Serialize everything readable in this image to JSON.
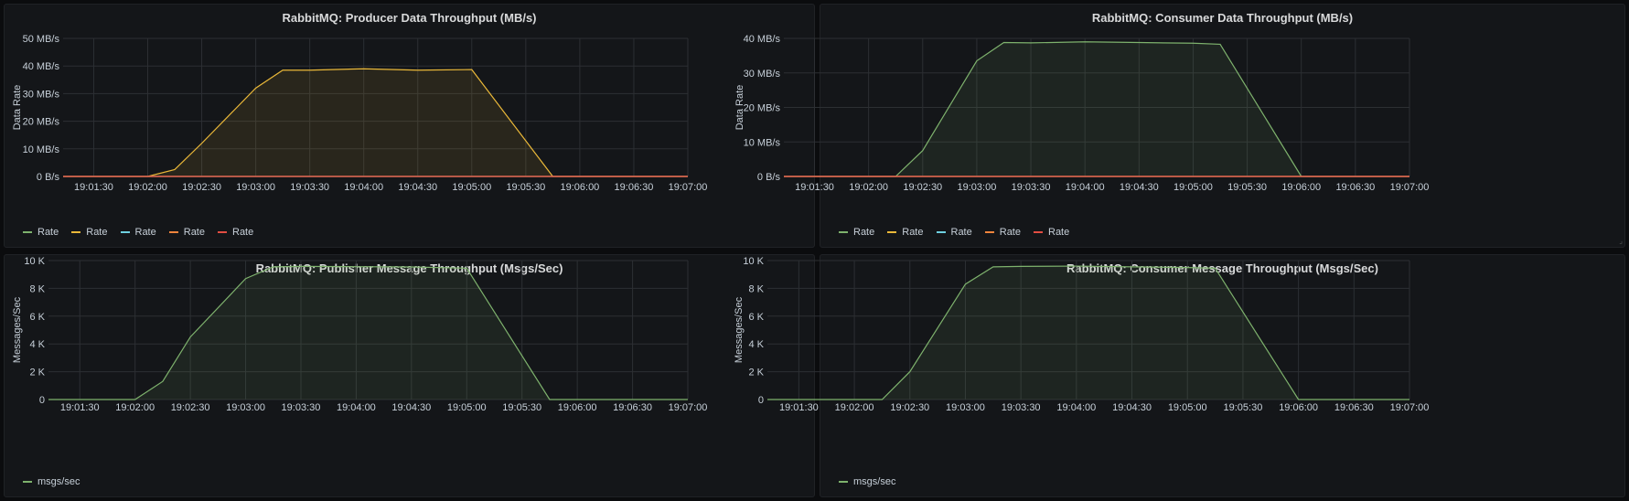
{
  "time_ticks": [
    "19:01:30",
    "19:02:00",
    "19:02:30",
    "19:03:00",
    "19:03:30",
    "19:04:00",
    "19:04:30",
    "19:05:00",
    "19:05:30",
    "19:06:00",
    "19:06:30",
    "19:07:00"
  ],
  "colors": {
    "green": "#7eb26d",
    "yellow": "#eab839",
    "teal": "#6ed0e0",
    "orange": "#ef843c",
    "red": "#e24d42",
    "grid": "#2c2f33",
    "text": "#c7d0d9"
  },
  "chart_data": [
    {
      "id": "producer",
      "type": "area",
      "title": "RabbitMQ: Producer Data Throughput (MB/s)",
      "ylabel": "Data Rate",
      "xlim": [
        "19:01:13",
        "19:07:00"
      ],
      "ylim": [
        0,
        50
      ],
      "yticks": [
        0,
        10,
        20,
        30,
        40,
        50
      ],
      "ytick_labels": [
        "0 B/s",
        "10 MB/s",
        "20 MB/s",
        "30 MB/s",
        "40 MB/s",
        "50 MB/s"
      ],
      "grid": true,
      "legend_position": "bottom-left",
      "series": [
        {
          "name": "Rate",
          "color": "#7eb26d",
          "fill": false,
          "x": [
            "19:01:13",
            "19:07:00"
          ],
          "values": [
            0,
            0
          ]
        },
        {
          "name": "Rate",
          "color": "#eab839",
          "fill": true,
          "x": [
            "19:01:13",
            "19:01:45",
            "19:02:00",
            "19:02:15",
            "19:02:30",
            "19:03:00",
            "19:03:15",
            "19:03:30",
            "19:04:00",
            "19:04:30",
            "19:05:00",
            "19:05:45",
            "19:06:00",
            "19:07:00"
          ],
          "values": [
            0,
            0,
            0,
            2.5,
            12,
            32,
            38.5,
            38.5,
            39,
            38.5,
            38.7,
            0,
            0,
            0
          ]
        },
        {
          "name": "Rate",
          "color": "#6ed0e0",
          "fill": false,
          "x": [
            "19:01:13",
            "19:07:00"
          ],
          "values": [
            0,
            0
          ]
        },
        {
          "name": "Rate",
          "color": "#ef843c",
          "fill": false,
          "x": [
            "19:01:13",
            "19:07:00"
          ],
          "values": [
            0,
            0
          ]
        },
        {
          "name": "Rate",
          "color": "#e24d42",
          "fill": false,
          "x": [
            "19:01:13",
            "19:07:00"
          ],
          "values": [
            0,
            0
          ]
        }
      ]
    },
    {
      "id": "consumer-data",
      "type": "area",
      "title": "RabbitMQ: Consumer Data Throughput (MB/s)",
      "ylabel": "Data Rate",
      "xlim": [
        "19:01:13",
        "19:07:00"
      ],
      "ylim": [
        0,
        40
      ],
      "yticks": [
        0,
        10,
        20,
        30,
        40
      ],
      "ytick_labels": [
        "0 B/s",
        "10 MB/s",
        "20 MB/s",
        "30 MB/s",
        "40 MB/s"
      ],
      "grid": true,
      "legend_position": "bottom-left",
      "series": [
        {
          "name": "Rate",
          "color": "#7eb26d",
          "fill": true,
          "x": [
            "19:01:13",
            "19:02:00",
            "19:02:15",
            "19:02:30",
            "19:03:00",
            "19:03:15",
            "19:03:30",
            "19:04:00",
            "19:04:30",
            "19:05:00",
            "19:05:15",
            "19:06:00",
            "19:06:30",
            "19:07:00"
          ],
          "values": [
            0,
            0,
            0,
            7.5,
            33.5,
            38.8,
            38.7,
            39,
            38.8,
            38.6,
            38.3,
            0,
            0,
            0
          ]
        },
        {
          "name": "Rate",
          "color": "#eab839",
          "fill": false,
          "x": [
            "19:01:13",
            "19:07:00"
          ],
          "values": [
            0,
            0
          ]
        },
        {
          "name": "Rate",
          "color": "#6ed0e0",
          "fill": false,
          "x": [
            "19:01:13",
            "19:07:00"
          ],
          "values": [
            0,
            0
          ]
        },
        {
          "name": "Rate",
          "color": "#ef843c",
          "fill": false,
          "x": [
            "19:01:13",
            "19:07:00"
          ],
          "values": [
            0,
            0
          ]
        },
        {
          "name": "Rate",
          "color": "#e24d42",
          "fill": false,
          "x": [
            "19:01:13",
            "19:07:00"
          ],
          "values": [
            0,
            0
          ]
        }
      ]
    },
    {
      "id": "publisher-msgs",
      "type": "area",
      "title": "RabbitMQ: Publisher Message Throughput (Msgs/Sec)",
      "ylabel": "Messages/Sec",
      "xlim": [
        "19:01:13",
        "19:07:00"
      ],
      "ylim": [
        0,
        10000
      ],
      "yticks": [
        0,
        2000,
        4000,
        6000,
        8000,
        10000
      ],
      "ytick_labels": [
        "0",
        "2 K",
        "4 K",
        "6 K",
        "8 K",
        "10 K"
      ],
      "grid": true,
      "legend_position": "bottom-left",
      "series": [
        {
          "name": "msgs/sec",
          "color": "#7eb26d",
          "fill": true,
          "x": [
            "19:01:13",
            "19:01:45",
            "19:02:00",
            "19:02:15",
            "19:02:30",
            "19:03:00",
            "19:03:15",
            "19:03:30",
            "19:04:00",
            "19:04:30",
            "19:05:00",
            "19:05:45",
            "19:06:00",
            "19:07:00"
          ],
          "values": [
            0,
            0,
            0,
            1300,
            4500,
            8700,
            9550,
            9580,
            9560,
            9540,
            9450,
            0,
            0,
            0
          ]
        }
      ]
    },
    {
      "id": "consumer-msgs",
      "type": "area",
      "title": "RabbitMQ: Consumer Message Throughput (Msgs/Sec)",
      "ylabel": "Messages/Sec",
      "xlim": [
        "19:01:13",
        "19:07:00"
      ],
      "ylim": [
        0,
        10000
      ],
      "yticks": [
        0,
        2000,
        4000,
        6000,
        8000,
        10000
      ],
      "ytick_labels": [
        "0",
        "2 K",
        "4 K",
        "6 K",
        "8 K",
        "10 K"
      ],
      "grid": true,
      "legend_position": "bottom-left",
      "series": [
        {
          "name": "msgs/sec",
          "color": "#7eb26d",
          "fill": true,
          "x": [
            "19:01:13",
            "19:02:00",
            "19:02:15",
            "19:02:30",
            "19:03:00",
            "19:03:15",
            "19:03:30",
            "19:04:00",
            "19:04:30",
            "19:05:00",
            "19:05:15",
            "19:06:00",
            "19:06:30",
            "19:07:00"
          ],
          "values": [
            0,
            0,
            0,
            2000,
            8300,
            9550,
            9580,
            9600,
            9550,
            9500,
            9450,
            0,
            0,
            0
          ]
        }
      ]
    }
  ]
}
